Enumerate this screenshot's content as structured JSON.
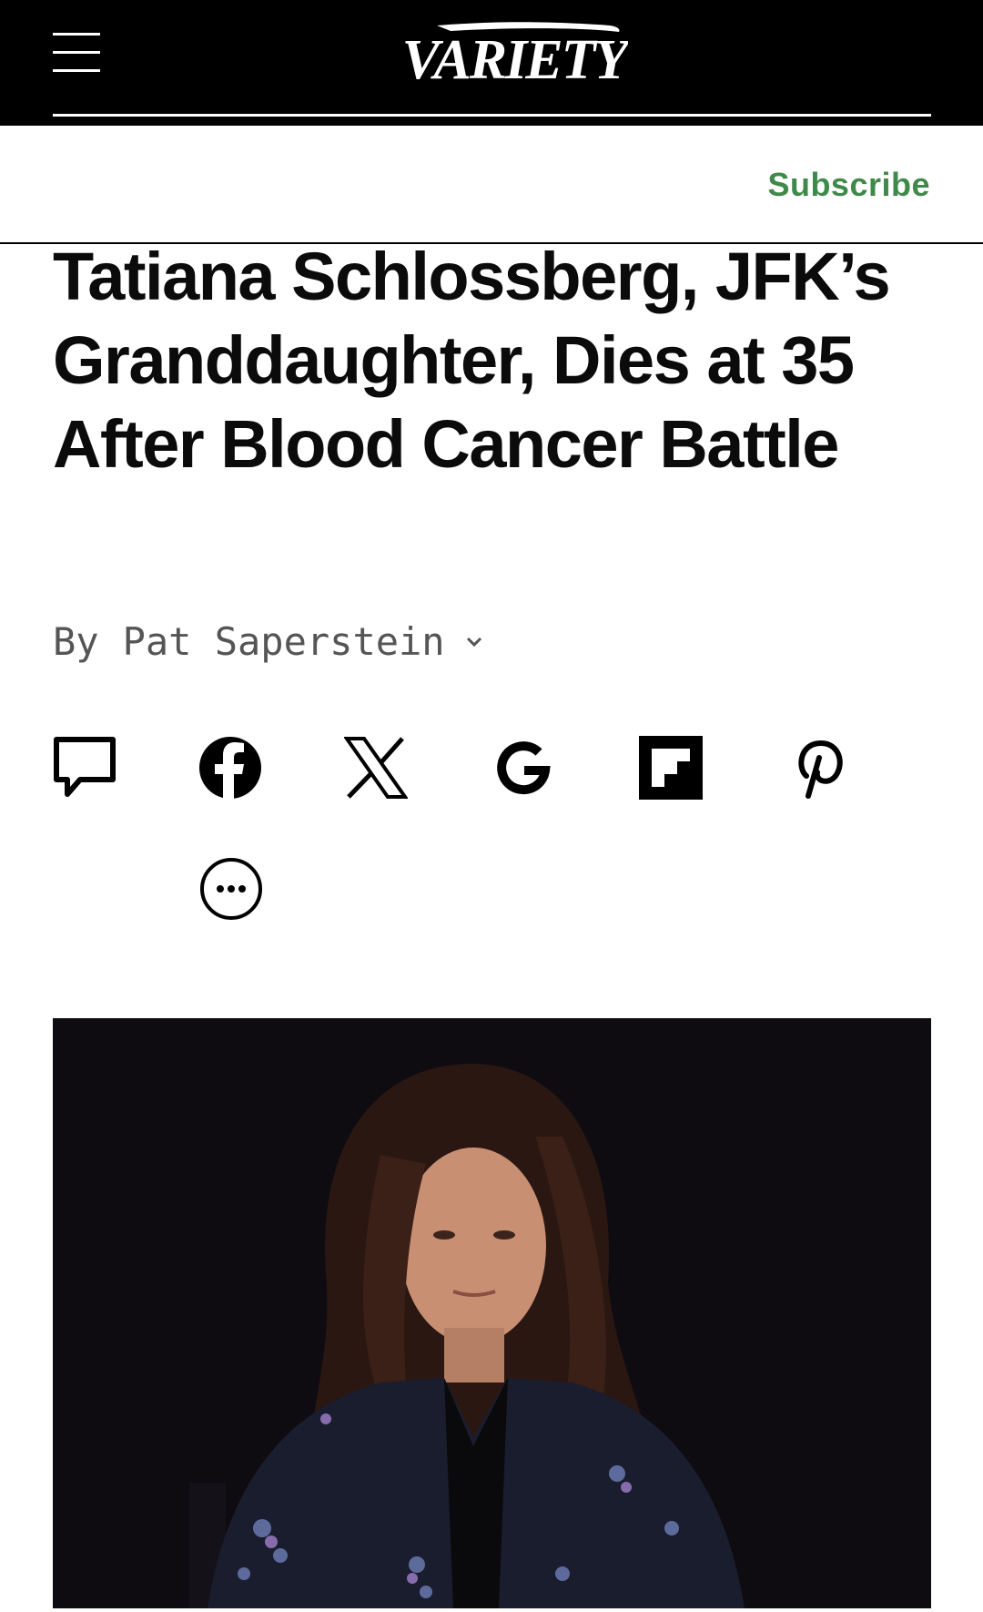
{
  "header": {
    "brand": "VARIETY",
    "subscribe_label": "Subscribe",
    "accent_color": "#3f8a4a"
  },
  "article": {
    "headline": "Tatiana Schlossberg, JFK’s Granddaughter, Dies at 35 After Blood Cancer Battle",
    "byline_prefix": "By",
    "author": "Pat Saperstein"
  },
  "share": {
    "icons": [
      "comment-icon",
      "facebook-icon",
      "x-icon",
      "google-icon",
      "flipboard-icon",
      "pinterest-icon",
      "more-icon"
    ]
  }
}
